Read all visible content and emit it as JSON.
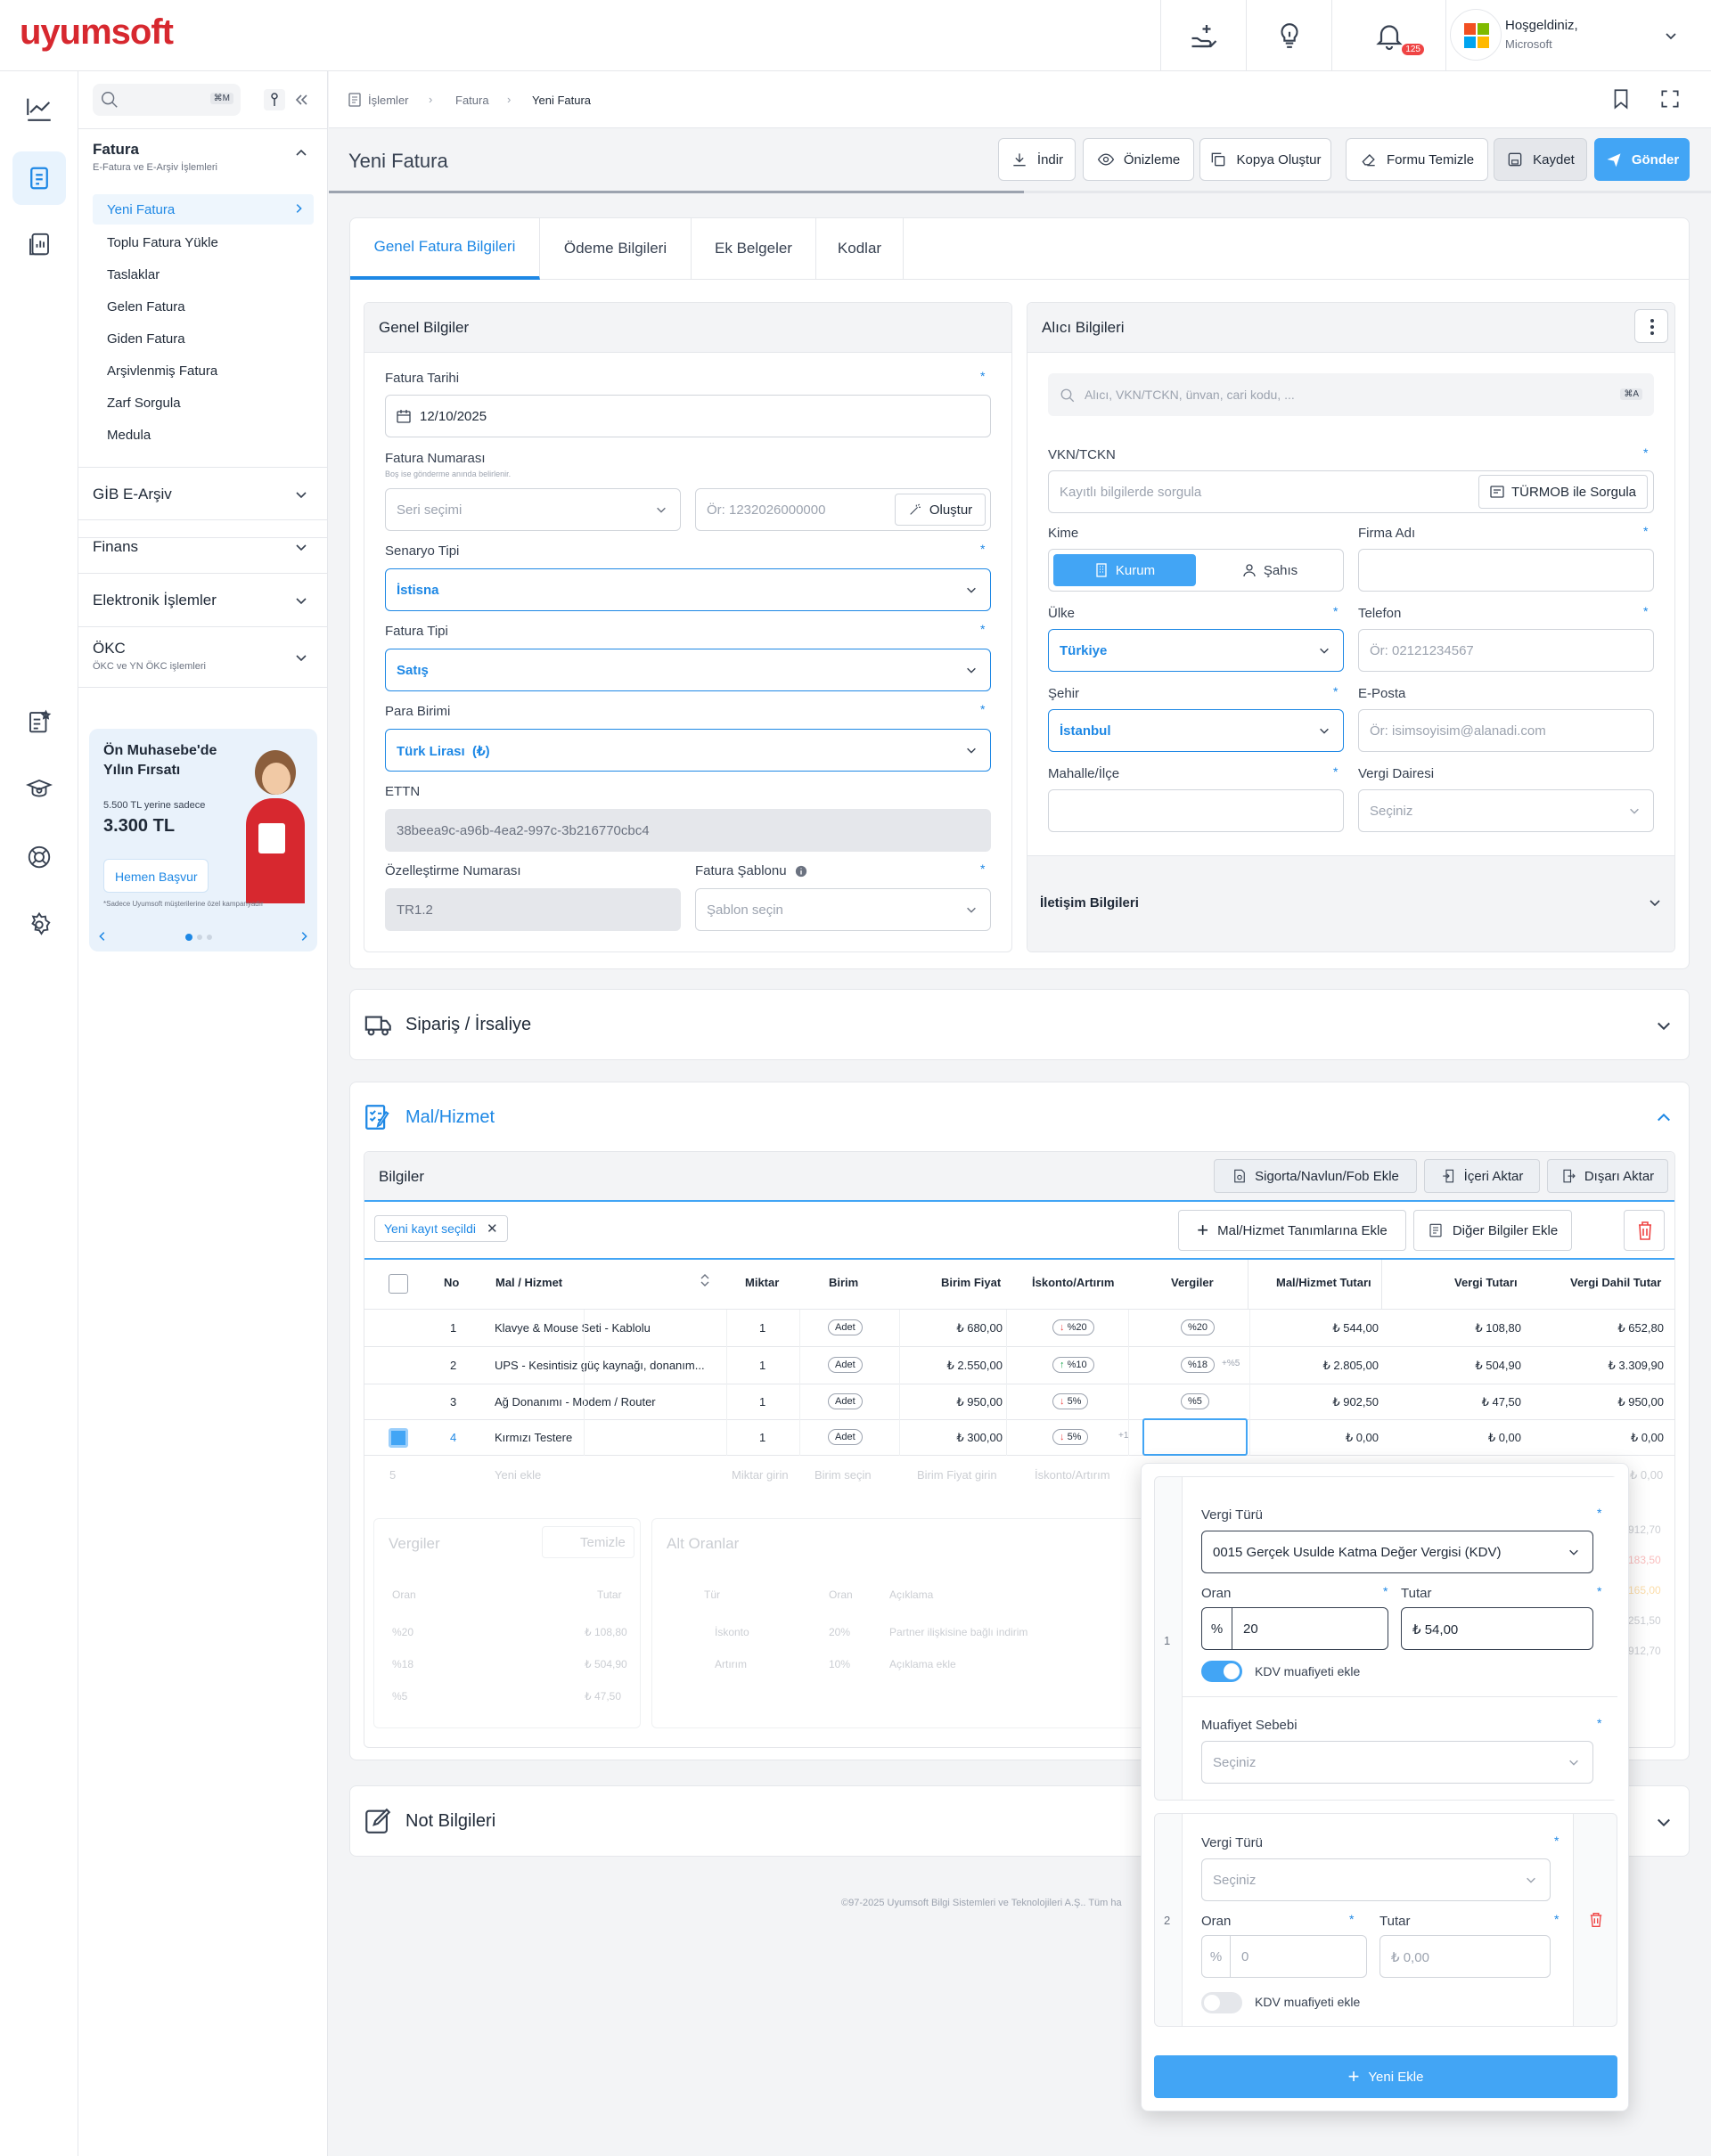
{
  "brand": "uyumsoft",
  "header": {
    "notif_count": "125",
    "greeting": "Hoşgeldiniz,",
    "company": "Microsoft"
  },
  "search": {
    "shortcut": "⌘M"
  },
  "menu": {
    "fatura": {
      "title": "Fatura",
      "subtitle": "E-Fatura ve E-Arşiv İşlemleri",
      "items": [
        "Yeni Fatura",
        "Toplu Fatura Yükle",
        "Taslaklar",
        "Gelen Fatura",
        "Giden Fatura",
        "Arşivlenmiş Fatura",
        "Zarf Sorgula",
        "Medula"
      ]
    },
    "gib": "GİB E-Arşiv",
    "finans": "Finans",
    "elektronik": "Elektronik İşlemler",
    "okc": {
      "title": "ÖKC",
      "subtitle": "ÖKC ve YN ÖKC işlemleri"
    }
  },
  "promo": {
    "title1": "Ön Muhasebe'de",
    "title2": "Yılın Fırsatı",
    "old_price": "5.500 TL yerine sadece",
    "price": "3.300 TL",
    "button": "Hemen Başvur",
    "note": "*Sadece Uyumsoft müşterilerine özel kampanyadır"
  },
  "breadcrumb": [
    "İşlemler",
    "Fatura",
    "Yeni Fatura"
  ],
  "page_title": "Yeni Fatura",
  "actions": {
    "indir": "İndir",
    "onizleme": "Önizleme",
    "kopya": "Kopya Oluştur",
    "temizle": "Formu Temizle",
    "kaydet": "Kaydet",
    "gonder": "Gönder"
  },
  "tabs": [
    "Genel Fatura Bilgileri",
    "Ödeme Bilgileri",
    "Ek Belgeler",
    "Kodlar"
  ],
  "genel": {
    "title": "Genel Bilgiler",
    "fatura_tarihi": {
      "label": "Fatura Tarihi",
      "value": "12/10/2025"
    },
    "fatura_no": {
      "label": "Fatura Numarası",
      "hint": "Boş ise gönderme anında belirlenir.",
      "seri_placeholder": "Seri seçimi",
      "no_placeholder": "Ör: 1232026000000",
      "olustur": "Oluştur"
    },
    "senaryo": {
      "label": "Senaryo Tipi",
      "value": "İstisna"
    },
    "tip": {
      "label": "Fatura Tipi",
      "value": "Satış"
    },
    "para": {
      "label": "Para Birimi",
      "value": "Türk Lirası  (₺)"
    },
    "ettn": {
      "label": "ETTN",
      "value": "38beea9c-a96b-4ea2-997c-3b216770cbc4"
    },
    "ozel": {
      "label": "Özelleştirme Numarası",
      "value": "TR1.2"
    },
    "sablon": {
      "label": "Fatura Şablonu",
      "placeholder": "Şablon seçin"
    }
  },
  "alici": {
    "title": "Alıcı Bilgileri",
    "search_placeholder": "Alıcı, VKN/TCKN, ünvan, cari kodu, ...",
    "search_shortcut": "⌘A",
    "vkn": {
      "label": "VKN/TCKN",
      "placeholder": "Kayıtlı bilgilerde sorgula",
      "button": "TÜRMOB ile Sorgula"
    },
    "kime": {
      "label": "Kime",
      "opt1": "Kurum",
      "opt2": "Şahıs"
    },
    "firma": {
      "label": "Firma Adı"
    },
    "ulke": {
      "label": "Ülke",
      "value": "Türkiye"
    },
    "telefon": {
      "label": "Telefon",
      "placeholder": "Ör: 02121234567"
    },
    "sehir": {
      "label": "Şehir",
      "value": "İstanbul"
    },
    "eposta": {
      "label": "E-Posta",
      "placeholder": "Ör: isimsoyisim@alanadi.com"
    },
    "mahalle": {
      "label": "Mahalle/İlçe"
    },
    "vd": {
      "label": "Vergi Dairesi",
      "placeholder": "Seçiniz"
    },
    "iletisim": "İletişim Bilgileri"
  },
  "siparis": "Sipariş / İrsaliye",
  "mal": {
    "title": "Mal/Hizmet",
    "bilgiler": "Bilgiler",
    "btn_sigorta": "Sigorta/Navlun/Fob Ekle",
    "btn_iceri": "İçeri Aktar",
    "btn_disari": "Dışarı Aktar",
    "chip": "Yeni kayıt seçildi",
    "btn_tanim": "Mal/Hizmet Tanımlarına Ekle",
    "btn_diger": "Diğer Bilgiler Ekle",
    "cols": [
      "No",
      "Mal / Hizmet",
      "Miktar",
      "Birim",
      "Birim Fiyat",
      "İskonto/Artırım",
      "Vergiler",
      "Mal/Hizmet Tutarı",
      "Vergi Tutarı",
      "Vergi Dahil Tutar"
    ],
    "rows": [
      {
        "no": "1",
        "name": "Klavye & Mouse Seti - Kablolu",
        "qty": "1",
        "unit": "Adet",
        "price": "₺ 680,00",
        "disc": "%20",
        "tax": "%20",
        "extra": "",
        "amount": "₺ 544,00",
        "vat": "₺ 108,80",
        "total": "₺ 652,80"
      },
      {
        "no": "2",
        "name": "UPS - Kesintisiz güç kaynağı, donanım...",
        "qty": "1",
        "unit": "Adet",
        "price": "₺ 2.550,00",
        "disc": "%10",
        "tax": "%18",
        "extra": "+%5",
        "amount": "₺ 2.805,00",
        "vat": "₺ 504,90",
        "total": "₺ 3.309,90"
      },
      {
        "no": "3",
        "name": "Ağ Donanımı - Modem / Router",
        "qty": "1",
        "unit": "Adet",
        "price": "₺ 950,00",
        "disc": "5%",
        "tax": "%5",
        "extra": "",
        "amount": "₺ 902,50",
        "vat": "₺ 47,50",
        "total": "₺ 950,00"
      },
      {
        "no": "4",
        "name": "Kırmızı Testere",
        "qty": "1",
        "unit": "Adet",
        "price": "₺ 300,00",
        "disc": "5%",
        "tax": "",
        "extra": "+1",
        "amount": "₺ 0,00",
        "vat": "₺ 0,00",
        "total": "₺ 0,00"
      }
    ],
    "new_row": {
      "no": "5",
      "name": "Yeni ekle",
      "qty": "Miktar girin",
      "unit": "Birim seçin",
      "price": "Birim Fiyat girin",
      "disc": "İskonto/Artırım",
      "total": "₺ 0,00"
    },
    "vergiler": {
      "title": "Vergiler",
      "temizle": "Temizle",
      "col_oran": "Oran",
      "col_tutar": "Tutar",
      "rows": [
        [
          "%20",
          "₺ 108,80"
        ],
        [
          "%18",
          "₺ 504,90"
        ],
        [
          "%5",
          "₺ 47,50"
        ]
      ]
    },
    "alt": {
      "title": "Alt Oranlar",
      "col_tur": "Tür",
      "col_oran": "Oran",
      "col_aciklama": "Açıklama",
      "rows": [
        [
          "İskonto",
          "20%",
          "Partner ilişkisine bağlı indirim"
        ],
        [
          "Artırım",
          "10%",
          "Açıklama ekle"
        ]
      ]
    },
    "right_totals": [
      "912,70",
      "183,50",
      "165,00",
      "251,50",
      "912,70"
    ]
  },
  "popup": {
    "g1": {
      "idx": "1",
      "vergi_label": "Vergi Türü",
      "vergi_value": "0015 Gerçek Usulde Katma Değer Vergisi (KDV)",
      "oran_label": "Oran",
      "oran_value": "20",
      "tutar_label": "Tutar",
      "tutar_value": "₺ 54,00",
      "kdv_toggle": "KDV muafiyeti ekle",
      "muaf_label": "Muafiyet Sebebi",
      "muaf_placeholder": "Seçiniz"
    },
    "g2": {
      "idx": "2",
      "vergi_label": "Vergi Türü",
      "vergi_placeholder": "Seçiniz",
      "oran_label": "Oran",
      "oran_placeholder": "0",
      "tutar_label": "Tutar",
      "tutar_placeholder": "₺ 0,00",
      "kdv_toggle": "KDV muafiyeti ekle"
    },
    "percent": "%",
    "yeni": "Yeni Ekle"
  },
  "not": "Not Bilgileri",
  "footer": "©97-2025 Uyumsoft Bilgi Sistemleri ve Teknolojileri A.Ş.. Tüm ha"
}
